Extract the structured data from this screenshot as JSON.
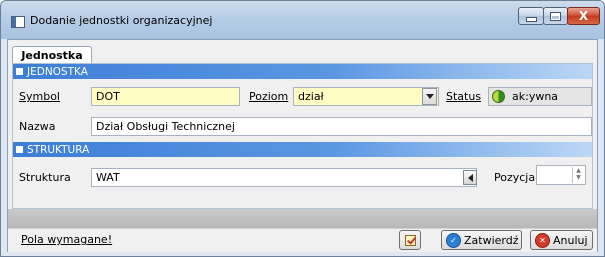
{
  "window": {
    "title": "Dodanie jednostki organizacyjnej",
    "min_icon": "minimize-icon",
    "max_icon": "maximize-icon",
    "close_glyph": "X"
  },
  "tab": {
    "label": "Jednostka"
  },
  "sections": {
    "jednostka": "JEDNOSTKA",
    "struktura": "STRUKTURA"
  },
  "form": {
    "symbol_label": "Symbol",
    "symbol_value": "DOT",
    "poziom_label": "Poziom",
    "poziom_value": "dział",
    "status_label": "Status",
    "status_value": "ak:ywna",
    "nazwa_label": "Nazwa",
    "nazwa_value": "Dział Obsługi Technicznej",
    "struktura_label": "Struktura",
    "struktura_value": "WAT",
    "pozycja_label": "Pozycja",
    "pozycja_value": ""
  },
  "footer": {
    "required_link": "Pola wymagane!",
    "confirm_label": "Zatwierdź",
    "cancel_label": "Anuluj"
  },
  "colors": {
    "required_field": "#fffdc4",
    "section_bar": "#3d7ed6",
    "status_active": "#2f8f1e"
  }
}
